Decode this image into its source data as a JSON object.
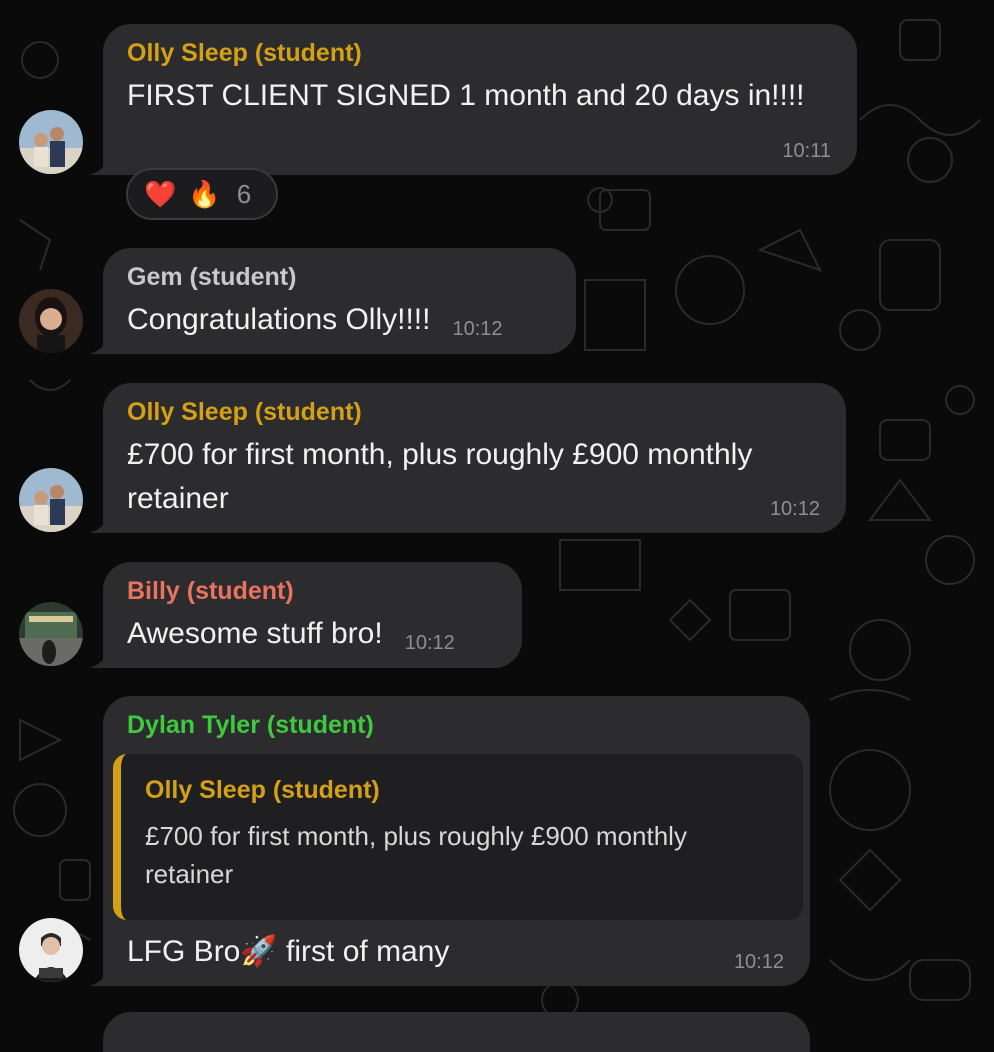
{
  "colors": {
    "background": "#0a0a0a",
    "bubble": "#2c2c2e",
    "olly": "#d4a015",
    "gem": "#c8c8d0",
    "billy": "#e8735f",
    "dylan": "#3ec93e",
    "time": "#8e8e93"
  },
  "messages": [
    {
      "sender": "Olly Sleep (student)",
      "text": "FIRST CLIENT SIGNED 1 month and 20 days in!!!!",
      "time": "10:11",
      "reactions": {
        "heart": "❤️",
        "fire": "🔥",
        "count": "6"
      }
    },
    {
      "sender": "Gem (student)",
      "text": "Congratulations Olly!!!!",
      "time": "10:12"
    },
    {
      "sender": "Olly Sleep (student)",
      "text": "£700 for first month, plus roughly £900 monthly retainer",
      "time": "10:12"
    },
    {
      "sender": "Billy (student)",
      "text": "Awesome stuff bro!",
      "time": "10:12"
    },
    {
      "sender": "Dylan Tyler (student)",
      "reply_to": {
        "sender": "Olly Sleep (student)",
        "text": "£700 for first month, plus roughly £900 monthly retainer"
      },
      "text": "LFG Bro🚀 first of many",
      "time": "10:12"
    }
  ]
}
